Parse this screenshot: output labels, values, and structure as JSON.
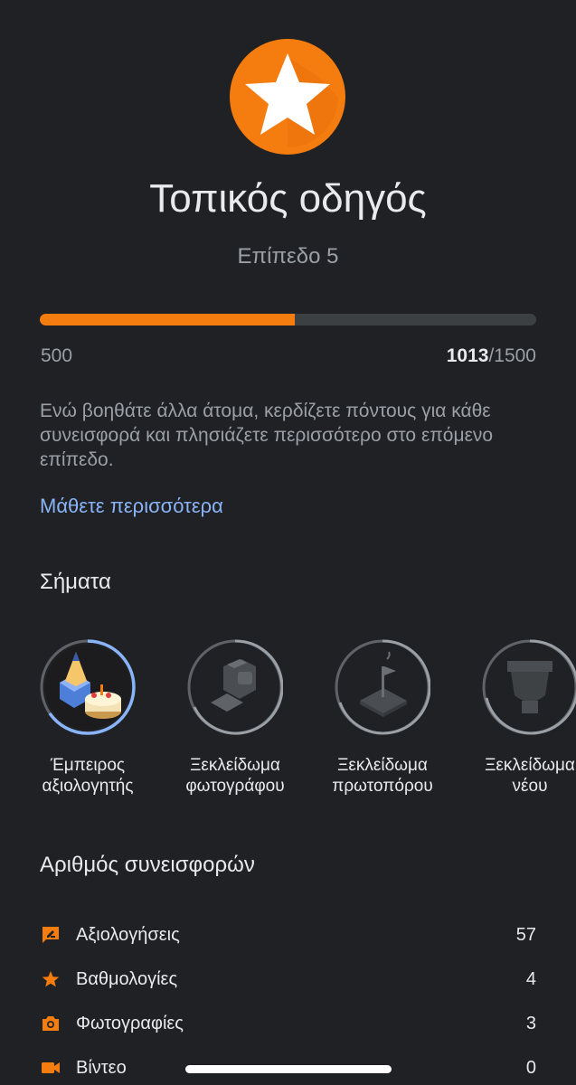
{
  "header": {
    "level_name": "Τοπικός οδηγός",
    "level_subtitle": "Επίπεδο 5",
    "icon": "star-icon",
    "accent_color": "#f57c0f"
  },
  "progress": {
    "min_label": "500",
    "current": "1013",
    "max_label": "/1500",
    "min_value": 500,
    "current_value": 1013,
    "max_value": 1500
  },
  "description": "Ενώ βοηθάτε άλλα άτομα, κερδίζετε πόντους για κάθε συνεισφορά και πλησιάζετε περισσότερο στο επόμενο επίπεδο.",
  "learn_more_label": "Μάθετε περισσότερα",
  "badges": {
    "title": "Σήματα",
    "items": [
      {
        "label_line1": "Έμπειρος",
        "label_line2": "αξιολογητής",
        "icon": "pencil-castle-badge-icon",
        "unlocked": true
      },
      {
        "label_line1": "Ξεκλείδωμα",
        "label_line2": "φωτογράφου",
        "icon": "camera-badge-icon",
        "unlocked": false
      },
      {
        "label_line1": "Ξεκλείδωμα",
        "label_line2": "πρωτοπόρου",
        "icon": "flag-badge-icon",
        "unlocked": false
      },
      {
        "label_line1": "Ξεκλείδωμα",
        "label_line2": "νέου",
        "icon": "trophy-badge-icon",
        "unlocked": false
      }
    ]
  },
  "contributions": {
    "title": "Αριθμός συνεισφορών",
    "items": [
      {
        "label": "Αξιολογήσεις",
        "value": "57",
        "icon": "review-icon"
      },
      {
        "label": "Βαθμολογίες",
        "value": "4",
        "icon": "star-icon"
      },
      {
        "label": "Φωτογραφίες",
        "value": "3",
        "icon": "camera-icon"
      },
      {
        "label": "Βίντεο",
        "value": "0",
        "icon": "video-icon"
      }
    ]
  }
}
